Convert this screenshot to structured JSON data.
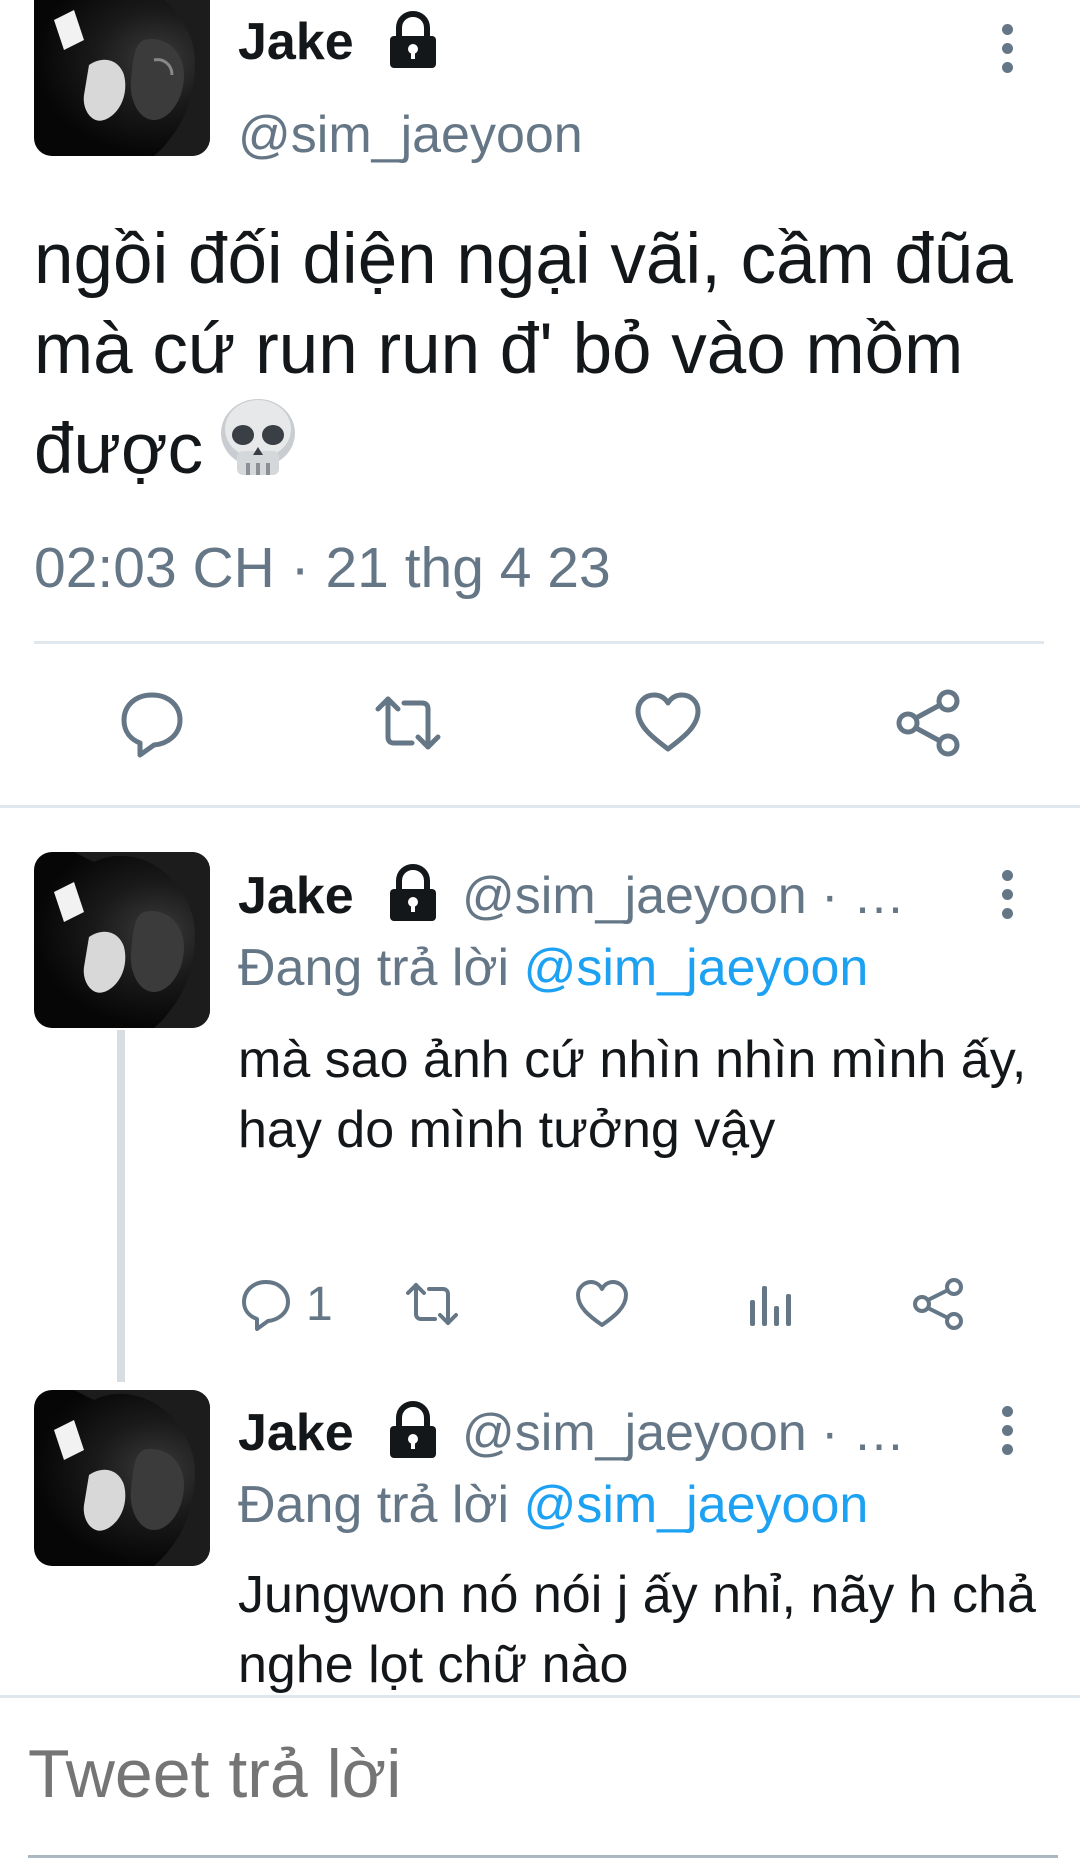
{
  "main_tweet": {
    "author_name": "Jake",
    "handle": "@sim_jaeyoon",
    "text": "ngồi đối diện ngại vãi, cầm đũa mà cứ run run đ' bỏ vào mồm được",
    "emoji": "skull",
    "timestamp": "02:03 CH · 21 thg 4 23"
  },
  "replies": [
    {
      "author_name": "Jake",
      "handle": "@sim_jaeyoon · …",
      "replying_label": "Đang trả lời",
      "replying_mention": "@sim_jaeyoon",
      "text": "mà sao ảnh cứ nhìn nhìn mình ấy, hay do mình tưởng vậy",
      "reply_count": "1"
    },
    {
      "author_name": "Jake",
      "handle": "@sim_jaeyoon · …",
      "replying_label": "Đang trả lời",
      "replying_mention": "@sim_jaeyoon",
      "text": "Jungwon nó nói j ấy nhỉ, nãy h chả nghe lọt chữ nào"
    }
  ],
  "compose": {
    "placeholder": "Tweet trả lời"
  },
  "colors": {
    "text": "#14171a",
    "secondary": "#657786",
    "accent": "#1da1f2",
    "divider": "#e1e8ed"
  },
  "icons": [
    "lock-icon",
    "more-icon",
    "reply-icon",
    "retweet-icon",
    "like-icon",
    "share-icon",
    "analytics-icon",
    "skull-emoji"
  ]
}
